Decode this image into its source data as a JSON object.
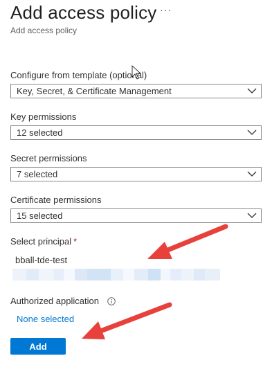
{
  "header": {
    "title": "Add access policy",
    "subtitle": "Add access policy",
    "more_icon": "ellipsis-icon"
  },
  "form": {
    "template": {
      "label": "Configure from template (optional)",
      "value": "Key, Secret, & Certificate Management"
    },
    "key_permissions": {
      "label": "Key permissions",
      "value": "12 selected"
    },
    "secret_permissions": {
      "label": "Secret permissions",
      "value": "7 selected"
    },
    "certificate_permissions": {
      "label": "Certificate permissions",
      "value": "15 selected"
    },
    "principal": {
      "label": "Select principal",
      "required_marker": "*",
      "value": "bball-tde-test"
    },
    "authorized_application": {
      "label": "Authorized application",
      "link": "None selected"
    },
    "add_button": "Add"
  },
  "colors": {
    "accent": "#0078d4",
    "required": "#a4262c",
    "annotation_arrow": "#e8403a"
  }
}
